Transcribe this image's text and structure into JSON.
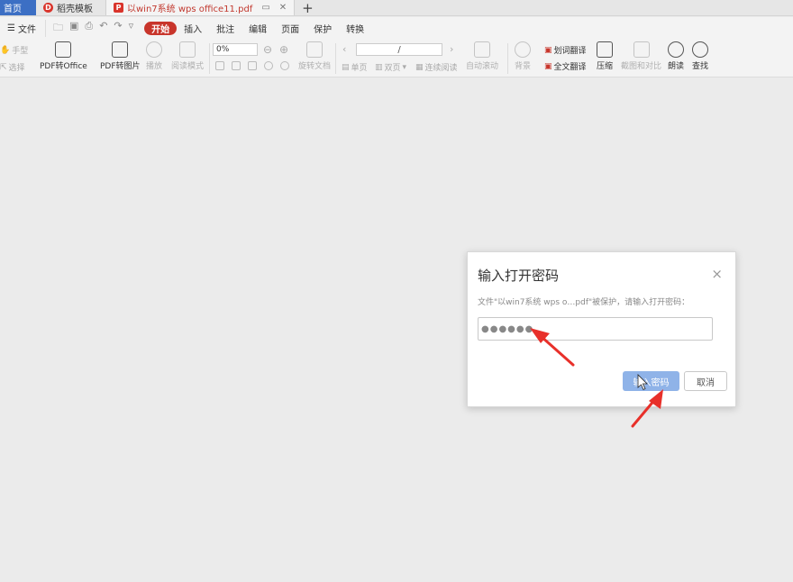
{
  "tabs": {
    "home": "首页",
    "template": "稻壳模板",
    "document": "以win7系统 wps office11.pdf"
  },
  "menu": {
    "file": "文件",
    "start": "开始",
    "insert": "插入",
    "annotate": "批注",
    "edit": "编辑",
    "page": "页面",
    "protect": "保护",
    "convert": "转换"
  },
  "ribbon": {
    "hand": "手型",
    "select": "选择",
    "pdf_to_office": "PDF转Office",
    "pdf_to_image": "PDF转图片",
    "play": "播放",
    "read_mode": "阅读模式",
    "zoom_value": "0%",
    "rotate_doc": "旋转文档",
    "page_value": "/",
    "single_page": "单页",
    "double_page": "双页",
    "continuous_read": "连续阅读",
    "auto_scroll": "自动滚动",
    "background": "背景",
    "word_translate": "划词翻译",
    "full_translate": "全文翻译",
    "compress": "压缩",
    "crop_compare": "截图和对比",
    "read_aloud": "朗读",
    "find": "查找"
  },
  "dialog": {
    "title": "输入打开密码",
    "close": "×",
    "message": "文件\"以win7系统 wps o…pdf\"被保护，请输入打开密码：",
    "password_value": "●●●●●●",
    "ok_label": "输入密码",
    "cancel_label": "取消"
  },
  "colors": {
    "accent_red": "#c8352b",
    "tab_blue": "#3c6fc4",
    "ok_blue": "#8fb3e8",
    "arrow_red": "#e8302a"
  }
}
